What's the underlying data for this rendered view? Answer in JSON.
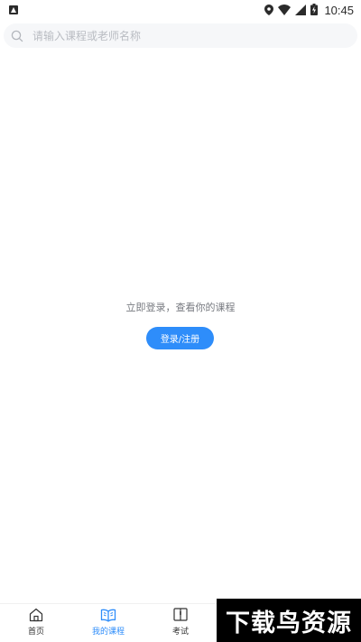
{
  "status_bar": {
    "time": "10:45",
    "icons": [
      "location-icon",
      "wifi-icon",
      "signal-icon",
      "battery-charging-icon"
    ]
  },
  "search": {
    "placeholder": "请输入课程或老师名称"
  },
  "empty_state": {
    "message": "立即登录，查看你的课程",
    "button_label": "登录/注册"
  },
  "bottom_nav": {
    "items": [
      {
        "label": "首页",
        "icon": "home-icon",
        "active": false
      },
      {
        "label": "我的课程",
        "icon": "open-book-icon",
        "active": true
      },
      {
        "label": "考试",
        "icon": "exam-book-icon",
        "active": false
      }
    ]
  },
  "watermark": {
    "text": "下载鸟资源"
  },
  "colors": {
    "accent": "#2e8dfa",
    "search_bg": "#f6f7f9",
    "text_muted": "#777a80"
  }
}
